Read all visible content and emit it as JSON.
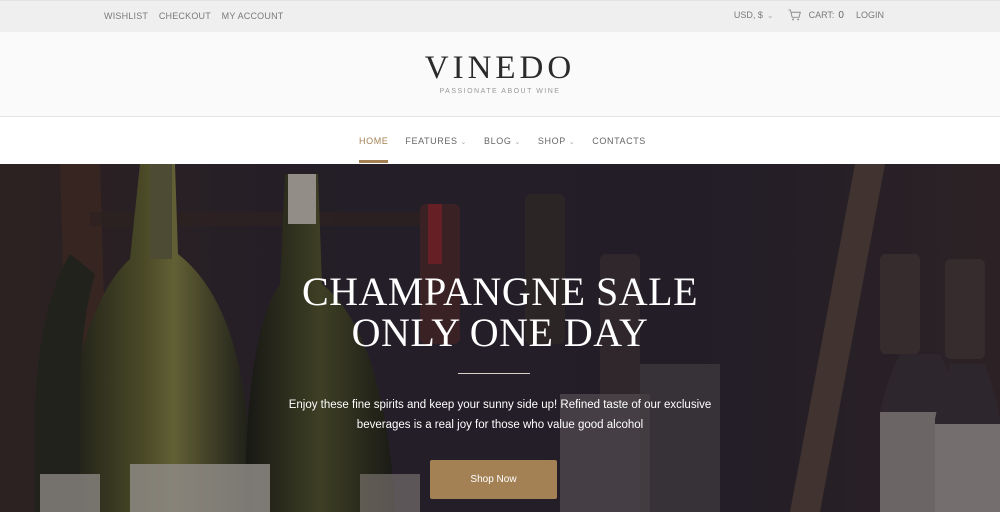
{
  "topbar": {
    "links": [
      "WISHLIST",
      "CHECKOUT",
      "MY ACCOUNT"
    ],
    "currency": "USD, $",
    "cart_label": "CART:",
    "cart_count": "0",
    "login": "LOGIN"
  },
  "header": {
    "logo": "VINEDO",
    "tagline": "PASSIONATE ABOUT WINE"
  },
  "nav": {
    "items": [
      {
        "label": "HOME",
        "dropdown": false,
        "active": true
      },
      {
        "label": "FEATURES",
        "dropdown": true,
        "active": false
      },
      {
        "label": "BLOG",
        "dropdown": true,
        "active": false
      },
      {
        "label": "SHOP",
        "dropdown": true,
        "active": false
      },
      {
        "label": "CONTACTS",
        "dropdown": false,
        "active": false
      }
    ]
  },
  "hero": {
    "title_line1": "CHAMPANGNE SALE",
    "title_line2": "ONLY ONE DAY",
    "text_line1": "Enjoy these fine spirits and keep your sunny side up! Refined taste of our exclusive",
    "text_line2": "beverages is a real joy for those who value good alcohol",
    "button": "Shop Now"
  },
  "colors": {
    "accent": "#a48154",
    "topbar_bg": "#efefef",
    "hero_dark": "#2a2228"
  }
}
